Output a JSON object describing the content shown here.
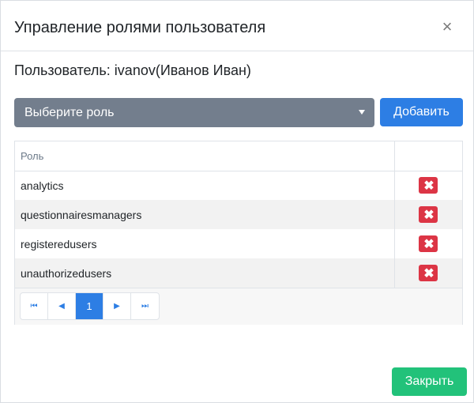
{
  "modal": {
    "title": "Управление ролями пользователя",
    "close_symbol": "×"
  },
  "user": {
    "label": "Пользователь: ivanov(Иванов Иван)"
  },
  "role_select": {
    "selected": "Выберите роль"
  },
  "add_button": "Добавить",
  "table": {
    "header_role": "Роль",
    "header_action": "",
    "rows": [
      {
        "role": "analytics",
        "delete_icon": "✖"
      },
      {
        "role": "questionnairesmanagers",
        "delete_icon": "✖"
      },
      {
        "role": "registeredusers",
        "delete_icon": "✖"
      },
      {
        "role": "unauthorizedusers",
        "delete_icon": "✖"
      }
    ]
  },
  "pager": {
    "first": "⏮",
    "prev": "◀",
    "current": "1",
    "next": "▶",
    "last": "⏭"
  },
  "footer": {
    "close_label": "Закрыть"
  },
  "colors": {
    "select_bg": "#737e8d",
    "primary": "#2d7ee4",
    "danger": "#dc3545",
    "success": "#22c27a"
  }
}
